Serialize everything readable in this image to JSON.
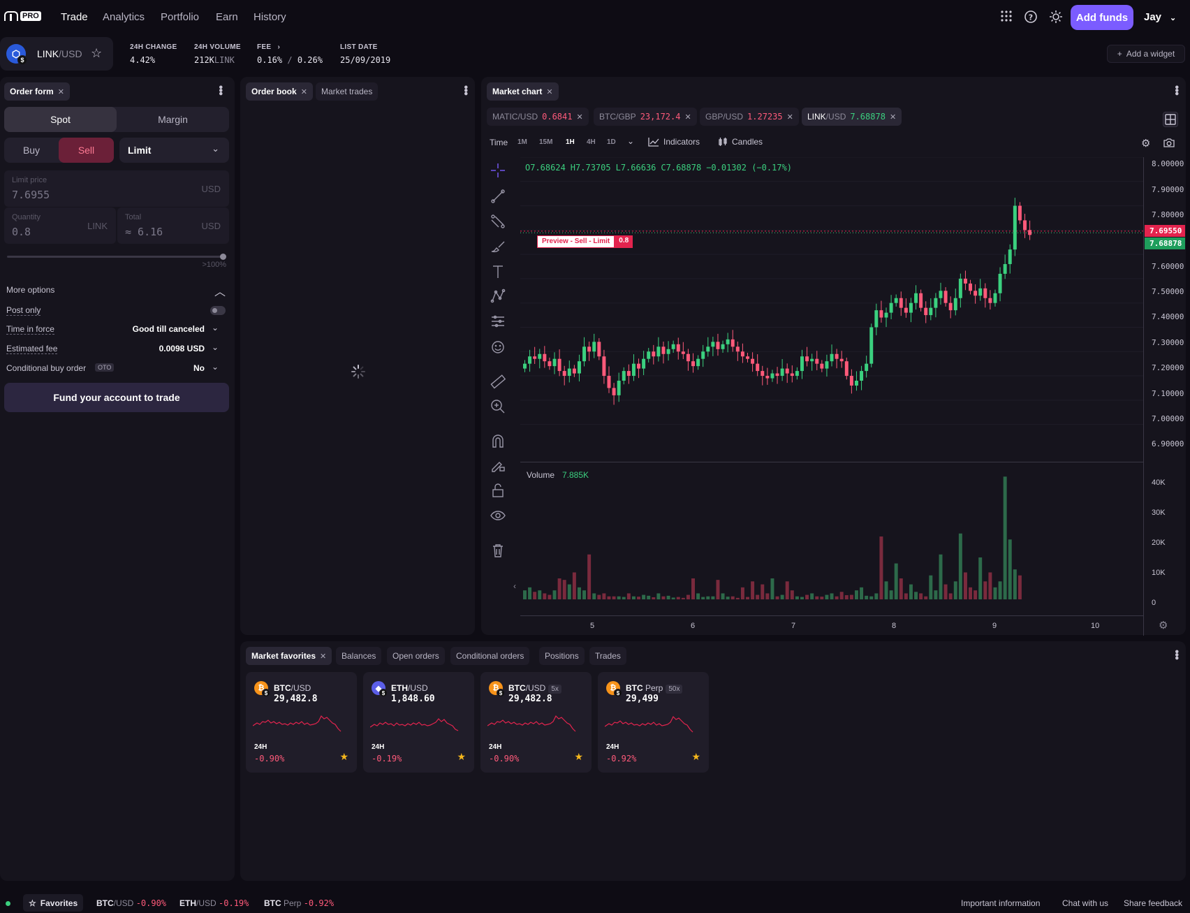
{
  "nav": {
    "logo_text": "PRO",
    "items": [
      "Trade",
      "Analytics",
      "Portfolio",
      "Earn",
      "History"
    ],
    "add_funds": "Add funds",
    "user": "Jay"
  },
  "ticker": {
    "base": "LINK",
    "quote": "/USD",
    "stats": [
      {
        "label": "24H CHANGE",
        "value": "4.42%"
      },
      {
        "label": "24H VOLUME",
        "value": "212K",
        "unit": "LINK"
      },
      {
        "label": "FEE",
        "value": "0.16%",
        "value2": "0.26%"
      },
      {
        "label": "LIST DATE",
        "value": "25/09/2019"
      }
    ],
    "add_widget": "Add a widget"
  },
  "order_form": {
    "tab": "Order form",
    "spot": "Spot",
    "margin": "Margin",
    "buy": "Buy",
    "sell": "Sell",
    "order_type": "Limit",
    "limit_price_label": "Limit price",
    "limit_price": "7.6955",
    "limit_unit": "USD",
    "quantity_label": "Quantity",
    "quantity": "0.8",
    "quantity_unit": "LINK",
    "total_label": "Total",
    "total": "≈ 6.16",
    "total_unit": "USD",
    "slider_label": ">100%",
    "slider_value": 1.0,
    "more_options": "More options",
    "post_only": "Post only",
    "time_in_force_label": "Time in force",
    "time_in_force": "Good till canceled",
    "est_fee_label": "Estimated fee",
    "est_fee": "0.0098 USD",
    "conditional_label": "Conditional buy order",
    "oto": "OTO",
    "conditional": "No",
    "fund_button": "Fund your account to trade"
  },
  "order_book": {
    "tabs": [
      "Order book",
      "Market trades"
    ]
  },
  "chart": {
    "tab": "Market chart",
    "pairs": [
      {
        "base": "MATIC",
        "quote": "/USD",
        "price": "0.6841",
        "color": "#ff5a7a"
      },
      {
        "base": "BTC",
        "quote": "/GBP",
        "price": "23,172.4",
        "color": "#ff5a7a"
      },
      {
        "base": "GBP",
        "quote": "/USD",
        "price": "1.27235",
        "color": "#ff5a7a"
      },
      {
        "base": "LINK",
        "quote": "/USD",
        "price": "7.68878",
        "color": "#3bd07f"
      }
    ],
    "time_label": "Time",
    "timeframes": [
      "1M",
      "15M",
      "1H",
      "4H",
      "1D"
    ],
    "indicators": "Indicators",
    "candles": "Candles",
    "ohlc": {
      "o": "O7.68624",
      "h": "H7.73705",
      "l": "L7.66636",
      "c": "C7.68878",
      "chg": "−0.01302 (−0.17%)"
    },
    "preview": {
      "text": "Preview -  Sell - Limit",
      "qty": "0.8"
    },
    "price_axis": [
      "8.00000",
      "7.90000",
      "7.80000",
      "7.60000",
      "7.50000",
      "7.40000",
      "7.30000",
      "7.20000",
      "7.10000",
      "7.00000",
      "6.90000"
    ],
    "price_tag_sell": "7.69550",
    "price_tag_last": "7.68878",
    "volume_label": "Volume",
    "volume_value": "7.885K",
    "volume_axis": [
      "40K",
      "30K",
      "20K",
      "10K",
      "0"
    ],
    "x_axis": [
      "5",
      "6",
      "7",
      "8",
      "9",
      "10"
    ]
  },
  "chart_data": {
    "type": "candlestick",
    "ylim": [
      6.85,
      8.0
    ],
    "volume_ylim": [
      0,
      42000
    ],
    "note_candles": "hourly candles, approximate closes",
    "closes": [
      7.15,
      7.18,
      7.17,
      7.19,
      7.16,
      7.14,
      7.17,
      7.12,
      7.1,
      7.13,
      7.11,
      7.16,
      7.22,
      7.2,
      7.24,
      7.18,
      7.1,
      7.05,
      7.02,
      7.08,
      7.12,
      7.1,
      7.15,
      7.13,
      7.17,
      7.2,
      7.18,
      7.22,
      7.19,
      7.21,
      7.23,
      7.2,
      7.19,
      7.16,
      7.14,
      7.17,
      7.2,
      7.22,
      7.24,
      7.21,
      7.23,
      7.25,
      7.22,
      7.2,
      7.18,
      7.17,
      7.15,
      7.12,
      7.1,
      7.09,
      7.11,
      7.1,
      7.13,
      7.11,
      7.1,
      7.12,
      7.18,
      7.16,
      7.17,
      7.15,
      7.13,
      7.16,
      7.19,
      7.17,
      7.16,
      7.1,
      7.06,
      7.08,
      7.12,
      7.15,
      7.3,
      7.37,
      7.34,
      7.36,
      7.4,
      7.42,
      7.38,
      7.36,
      7.4,
      7.44,
      7.38,
      7.35,
      7.38,
      7.42,
      7.45,
      7.4,
      7.37,
      7.42,
      7.5,
      7.48,
      7.45,
      7.43,
      7.46,
      7.42,
      7.4,
      7.44,
      7.52,
      7.56,
      7.62,
      7.8,
      7.74,
      7.7,
      7.68
    ],
    "volumes": [
      3000,
      4000,
      2500,
      3000,
      2000,
      1500,
      3000,
      7000,
      6500,
      5000,
      9000,
      4000,
      3000,
      15000,
      2000,
      1500,
      2000,
      1000,
      1000,
      1000,
      800,
      2000,
      1000,
      900,
      1500,
      1200,
      700,
      2000,
      1000,
      1200,
      600,
      800,
      500,
      1500,
      7000,
      2000,
      800,
      1000,
      1000,
      6500,
      2000,
      900,
      1000,
      500,
      4000,
      800,
      6000,
      1500,
      5000,
      2000,
      7000,
      1000,
      1500,
      6000,
      3000,
      1000,
      800,
      1500,
      2000,
      1000,
      900,
      1500,
      2000,
      1000,
      2500,
      1400,
      1500,
      3000,
      4000,
      1200,
      1000,
      2000,
      21000,
      6000,
      3000,
      12000,
      7000,
      2000,
      5000,
      2500,
      2000,
      1000,
      8000,
      3000,
      15000,
      5000,
      2000,
      6000,
      22000,
      9000,
      4000,
      3000,
      14000,
      6000,
      9000,
      4000,
      6000,
      41000,
      20000,
      10000,
      8000
    ]
  },
  "bottom": {
    "tabs": [
      "Market favorites",
      "Balances",
      "Open orders",
      "Conditional orders",
      "Positions",
      "Trades"
    ],
    "cards": [
      {
        "name": "BTC",
        "quote": "/USD",
        "lev": "",
        "price": "29,482.8",
        "h": "24H",
        "change": "-0.90%",
        "color": "#f7931a",
        "glyph": "₿"
      },
      {
        "name": "ETH",
        "quote": "/USD",
        "lev": "",
        "price": "1,848.60",
        "h": "24H",
        "change": "-0.19%",
        "color": "#5b5ee8",
        "glyph": "◆"
      },
      {
        "name": "BTC",
        "quote": "/USD",
        "lev": "5x",
        "price": "29,482.8",
        "h": "24H",
        "change": "-0.90%",
        "color": "#f7931a",
        "glyph": "₿"
      },
      {
        "name": "BTC",
        "quote": " Perp",
        "lev": "50x",
        "price": "29,499",
        "h": "24H",
        "change": "-0.92%",
        "color": "#f7931a",
        "glyph": "₿"
      }
    ]
  },
  "footer": {
    "favorites": "Favorites",
    "tickers": [
      {
        "base": "BTC",
        "quote": "/USD",
        "chg": "-0.90%"
      },
      {
        "base": "ETH",
        "quote": "/USD",
        "chg": "-0.19%"
      },
      {
        "base": "BTC",
        "quote": " Perp",
        "chg": "-0.92%"
      }
    ],
    "links": [
      "Important information",
      "Chat with us",
      "Share feedback"
    ]
  }
}
